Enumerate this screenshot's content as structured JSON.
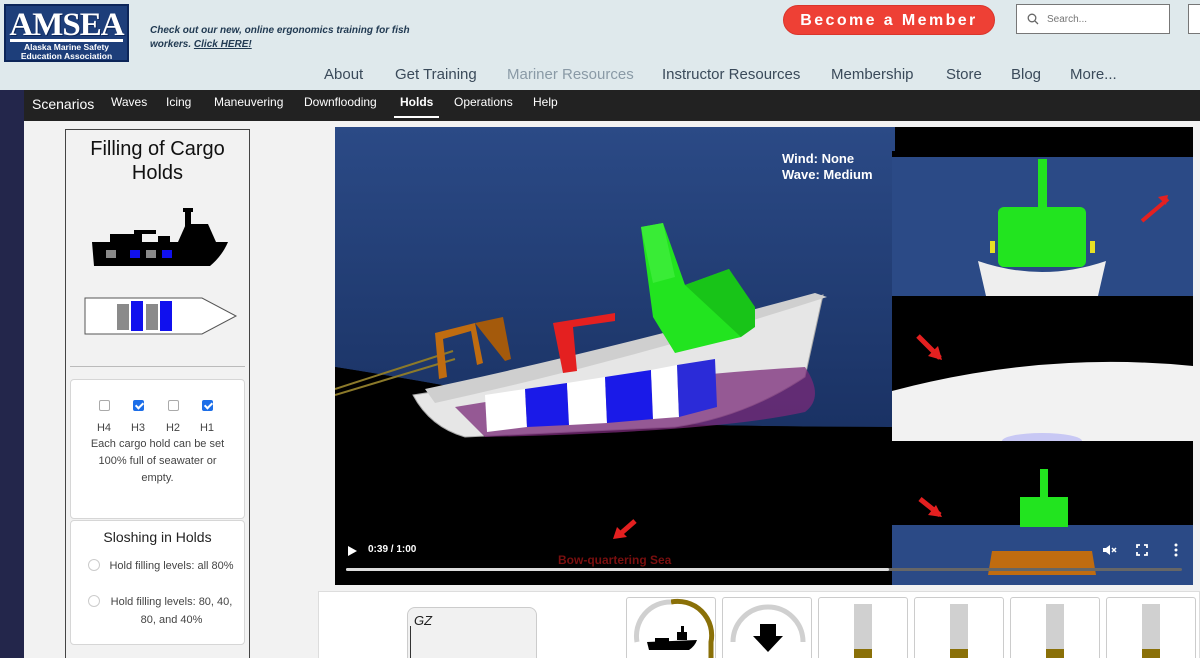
{
  "header": {
    "logo": {
      "title": "AMSEA",
      "subtitle_line1": "Alaska Marine Safety",
      "subtitle_line2": "Education Association"
    },
    "promo": {
      "text": "Check out our new, online ergonomics training for fish workers.",
      "link": "Click HERE!"
    },
    "cta_label": "Become a Member",
    "search_placeholder": "Search..."
  },
  "top_nav": [
    "About",
    "Get Training",
    "Mariner Resources",
    "Instructor Resources",
    "Membership",
    "Store",
    "Blog",
    "More..."
  ],
  "sub_nav": {
    "brand": "Scenarios",
    "items": [
      "Waves",
      "Icing",
      "Maneuvering",
      "Downflooding",
      "Holds",
      "Operations",
      "Help"
    ],
    "active": "Holds"
  },
  "panel": {
    "title_line1": "Filling of Cargo",
    "title_line2": "Holds",
    "holds": [
      {
        "label": "H4",
        "checked": false
      },
      {
        "label": "H3",
        "checked": true
      },
      {
        "label": "H2",
        "checked": false
      },
      {
        "label": "H1",
        "checked": true
      }
    ],
    "holds_note": "Each cargo hold can be set 100% full of seawater or empty.",
    "sloshing_title": "Sloshing in Holds",
    "sloshing_options": [
      "Hold filling levels: all 80%",
      "Hold filling levels: 80, 40, 80, and 40%"
    ]
  },
  "video": {
    "wind_label": "Wind: None",
    "wave_label": "Wave: Medium",
    "time": "0:39 / 1:00",
    "progress": 0.65,
    "caption": "Bow-quartering Sea"
  },
  "bottom": {
    "gz_label": "GZ",
    "bars": [
      0.25,
      0.25,
      0.25,
      0.25
    ]
  },
  "colors": {
    "accent_red": "#ee4035",
    "header_bg": "#dfe9ec",
    "nav_dark": "#222222",
    "hold_blue": "#1010ee",
    "superstructure_green": "#22e41f",
    "fill_gold": "#8a7008"
  }
}
